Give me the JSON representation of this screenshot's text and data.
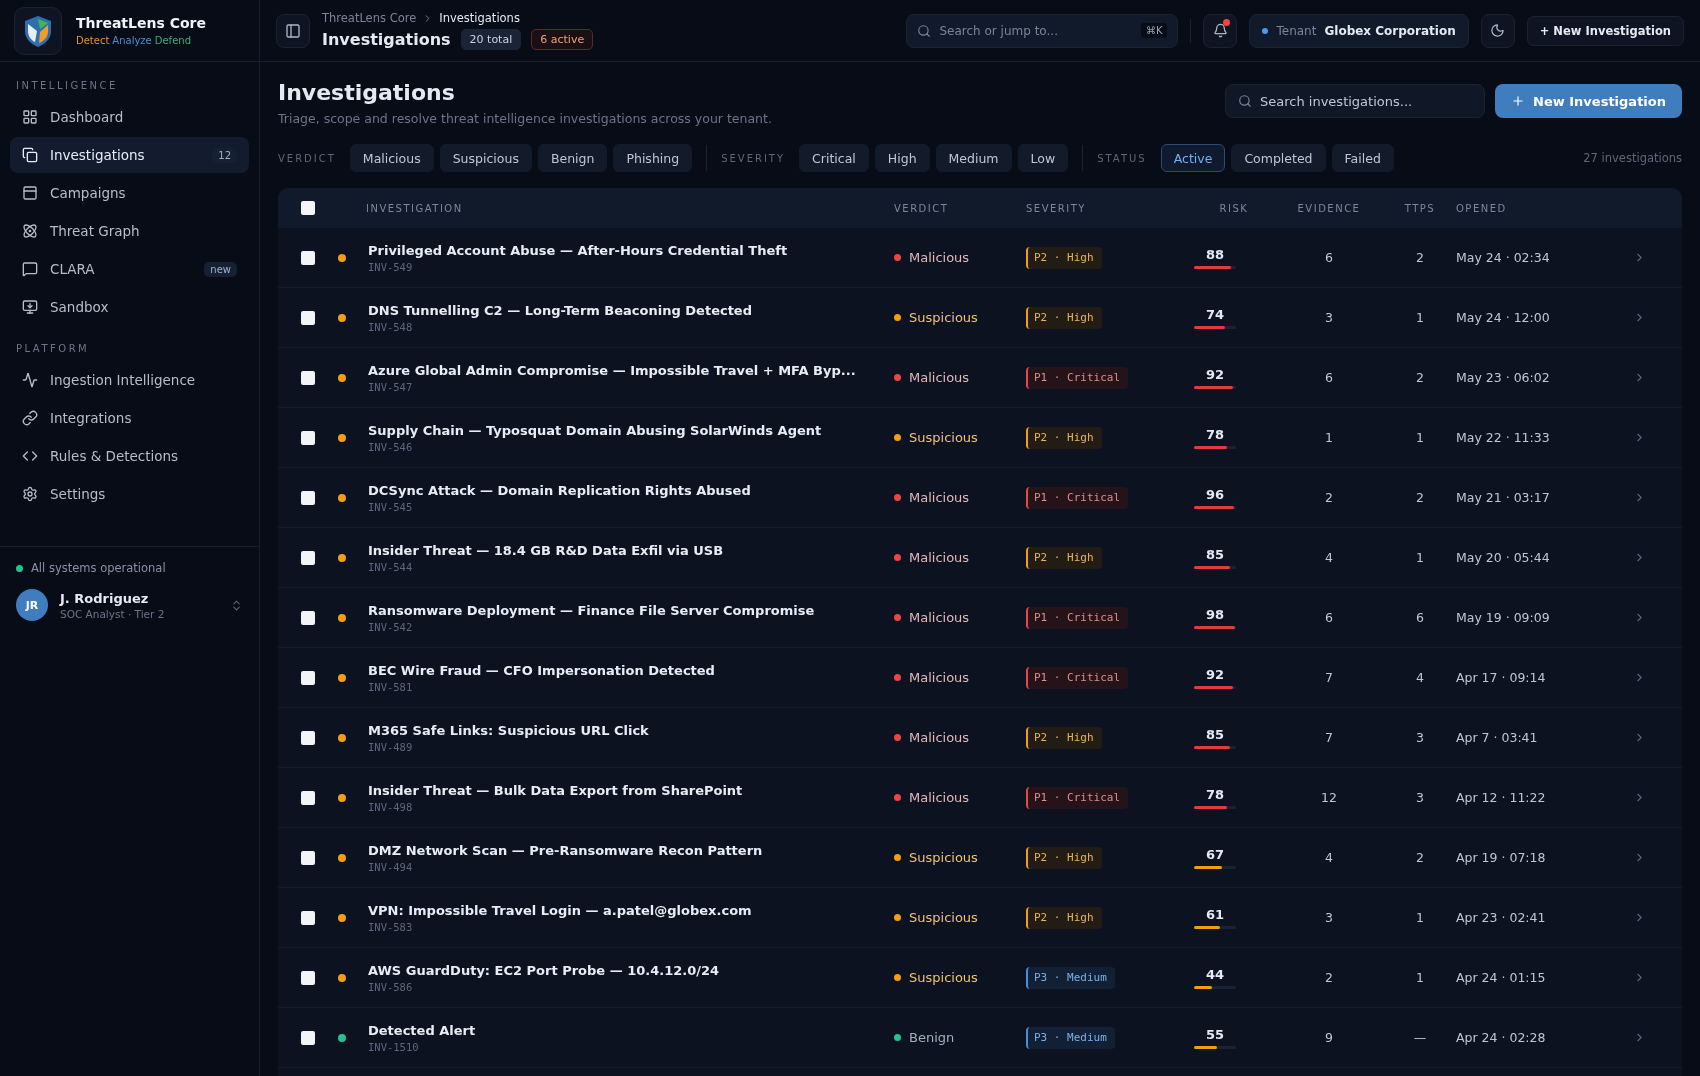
{
  "brand": {
    "name": "ThreatLens Core",
    "tagline": [
      {
        "text": "Detect",
        "color": "#e8922a"
      },
      {
        "text": "Analyze",
        "color": "#4a8fd6"
      },
      {
        "text": "Defend",
        "color": "#3fae7a"
      }
    ]
  },
  "sidebar": {
    "sections": [
      {
        "title": "INTELLIGENCE",
        "items": [
          {
            "label": "Dashboard",
            "selected": false
          },
          {
            "label": "Investigations",
            "selected": true,
            "badge": "12"
          },
          {
            "label": "Campaigns",
            "selected": false
          },
          {
            "label": "Threat Graph",
            "selected": false
          },
          {
            "label": "CLARA",
            "selected": false,
            "badge": "new"
          },
          {
            "label": "Sandbox",
            "selected": false
          }
        ]
      },
      {
        "title": "PLATFORM",
        "items": [
          {
            "label": "Ingestion Intelligence",
            "selected": false
          },
          {
            "label": "Integrations",
            "selected": false
          },
          {
            "label": "Rules & Detections",
            "selected": false
          },
          {
            "label": "Settings",
            "selected": false
          }
        ]
      }
    ],
    "status": "All systems operational",
    "user": {
      "initials": "JR",
      "name": "J. Rodriguez",
      "role": "SOC Analyst · Tier 2"
    }
  },
  "topbar": {
    "breadcrumb": [
      "ThreatLens Core",
      "Investigations"
    ],
    "title": "Investigations",
    "total": "20 total",
    "active": "6 active",
    "search_placeholder": "Search or jump to...",
    "shortcut": "⌘K",
    "tenant_label": "Tenant",
    "tenant": "Globex Corporation",
    "new_button": "+ New Investigation"
  },
  "page": {
    "title": "Investigations",
    "subtitle": "Triage, scope and resolve threat intelligence investigations across your tenant.",
    "search_placeholder": "Search investigations...",
    "new_button": "New Investigation",
    "count": "27 investigations"
  },
  "filters": [
    {
      "label": "VERDICT",
      "chips": [
        {
          "label": "Malicious",
          "selected": false
        },
        {
          "label": "Suspicious",
          "selected": false
        },
        {
          "label": "Benign",
          "selected": false
        },
        {
          "label": "Phishing",
          "selected": false
        }
      ]
    },
    {
      "label": "SEVERITY",
      "chips": [
        {
          "label": "Critical",
          "selected": false
        },
        {
          "label": "High",
          "selected": false
        },
        {
          "label": "Medium",
          "selected": false
        },
        {
          "label": "Low",
          "selected": false
        }
      ]
    },
    {
      "label": "STATUS",
      "chips": [
        {
          "label": "Active",
          "selected": true
        },
        {
          "label": "Completed",
          "selected": false
        },
        {
          "label": "Failed",
          "selected": false
        }
      ]
    }
  ],
  "table": {
    "select_all_checked": false,
    "columns": [
      "INVESTIGATION",
      "VERDICT",
      "SEVERITY",
      "RISK",
      "EVIDENCE",
      "TTPS",
      "OPENED"
    ],
    "rows": [
      {
        "checked": false,
        "color": "#f59e0b",
        "title": "Privileged Account Abuse — After-Hours Credential Theft",
        "id": "INV-549",
        "verdict": {
          "kind": "malicious",
          "label": "Malicious"
        },
        "severity": {
          "kind": "high",
          "label": "P2 · High"
        },
        "risk": "88",
        "level": 0.88,
        "evidence": "6",
        "ttps": "2",
        "opened": "May 24 · 02:34"
      },
      {
        "checked": false,
        "color": "#f59e0b",
        "title": "DNS Tunnelling C2 — Long-Term Beaconing Detected",
        "id": "INV-548",
        "verdict": {
          "kind": "suspicious",
          "label": "Suspicious"
        },
        "severity": {
          "kind": "high",
          "label": "P2 · High"
        },
        "risk": "74",
        "level": 0.74,
        "evidence": "3",
        "ttps": "1",
        "opened": "May 24 · 12:00"
      },
      {
        "checked": false,
        "color": "#f59e0b",
        "title": "Azure Global Admin Compromise — Impossible Travel + MFA Byp...",
        "id": "INV-547",
        "verdict": {
          "kind": "malicious",
          "label": "Malicious"
        },
        "severity": {
          "kind": "critical",
          "label": "P1 · Critical"
        },
        "risk": "92",
        "level": 0.92,
        "evidence": "6",
        "ttps": "2",
        "opened": "May 23 · 06:02"
      },
      {
        "checked": false,
        "color": "#f59e0b",
        "title": "Supply Chain — Typosquat Domain Abusing SolarWinds Agent",
        "id": "INV-546",
        "verdict": {
          "kind": "suspicious",
          "label": "Suspicious"
        },
        "severity": {
          "kind": "high",
          "label": "P2 · High"
        },
        "risk": "78",
        "level": 0.78,
        "evidence": "1",
        "ttps": "1",
        "opened": "May 22 · 11:33"
      },
      {
        "checked": false,
        "color": "#f59e0b",
        "title": "DCSync Attack — Domain Replication Rights Abused",
        "id": "INV-545",
        "verdict": {
          "kind": "malicious",
          "label": "Malicious"
        },
        "severity": {
          "kind": "critical",
          "label": "P1 · Critical"
        },
        "risk": "96",
        "level": 0.96,
        "evidence": "2",
        "ttps": "2",
        "opened": "May 21 · 03:17"
      },
      {
        "checked": false,
        "color": "#f59e0b",
        "title": "Insider Threat — 18.4 GB R&D Data Exfil via USB",
        "id": "INV-544",
        "verdict": {
          "kind": "malicious",
          "label": "Malicious"
        },
        "severity": {
          "kind": "high",
          "label": "P2 · High"
        },
        "risk": "85",
        "level": 0.85,
        "evidence": "4",
        "ttps": "1",
        "opened": "May 20 · 05:44"
      },
      {
        "checked": false,
        "color": "#f59e0b",
        "title": "Ransomware Deployment — Finance File Server Compromise",
        "id": "INV-542",
        "verdict": {
          "kind": "malicious",
          "label": "Malicious"
        },
        "severity": {
          "kind": "critical",
          "label": "P1 · Critical"
        },
        "risk": "98",
        "level": 0.98,
        "evidence": "6",
        "ttps": "6",
        "opened": "May 19 · 09:09"
      },
      {
        "checked": false,
        "color": "#f59e0b",
        "title": "BEC Wire Fraud — CFO Impersonation Detected",
        "id": "INV-581",
        "verdict": {
          "kind": "malicious",
          "label": "Malicious"
        },
        "severity": {
          "kind": "critical",
          "label": "P1 · Critical"
        },
        "risk": "92",
        "level": 0.92,
        "evidence": "7",
        "ttps": "4",
        "opened": "Apr 17 · 09:14"
      },
      {
        "checked": false,
        "color": "#f59e0b",
        "title": "M365 Safe Links: Suspicious URL Click",
        "id": "INV-489",
        "verdict": {
          "kind": "malicious",
          "label": "Malicious"
        },
        "severity": {
          "kind": "high",
          "label": "P2 · High"
        },
        "risk": "85",
        "level": 0.85,
        "evidence": "7",
        "ttps": "3",
        "opened": "Apr 7 · 03:41"
      },
      {
        "checked": false,
        "color": "#f59e0b",
        "title": "Insider Threat — Bulk Data Export from SharePoint",
        "id": "INV-498",
        "verdict": {
          "kind": "malicious",
          "label": "Malicious"
        },
        "severity": {
          "kind": "critical",
          "label": "P1 · Critical"
        },
        "risk": "78",
        "level": 0.78,
        "evidence": "12",
        "ttps": "3",
        "opened": "Apr 12 · 11:22"
      },
      {
        "checked": false,
        "color": "#f59e0b",
        "title": "DMZ Network Scan — Pre-Ransomware Recon Pattern",
        "id": "INV-494",
        "verdict": {
          "kind": "suspicious",
          "label": "Suspicious"
        },
        "severity": {
          "kind": "high",
          "label": "P2 · High"
        },
        "risk": "67",
        "level": 0.67,
        "evidence": "4",
        "ttps": "2",
        "opened": "Apr 19 · 07:18"
      },
      {
        "checked": false,
        "color": "#f59e0b",
        "title": "VPN: Impossible Travel Login — a.patel@globex.com",
        "id": "INV-583",
        "verdict": {
          "kind": "suspicious",
          "label": "Suspicious"
        },
        "severity": {
          "kind": "high",
          "label": "P2 · High"
        },
        "risk": "61",
        "level": 0.61,
        "evidence": "3",
        "ttps": "1",
        "opened": "Apr 23 · 02:41"
      },
      {
        "checked": false,
        "color": "#f59e0b",
        "title": "AWS GuardDuty: EC2 Port Probe — 10.4.12.0/24",
        "id": "INV-586",
        "verdict": {
          "kind": "suspicious",
          "label": "Suspicious"
        },
        "severity": {
          "kind": "medium",
          "label": "P3 · Medium"
        },
        "risk": "44",
        "level": 0.44,
        "evidence": "2",
        "ttps": "1",
        "opened": "Apr 24 · 01:15"
      },
      {
        "checked": false,
        "color": "#22c38e",
        "title": "Detected Alert",
        "id": "INV-1510",
        "verdict": {
          "kind": "benign",
          "label": "Benign"
        },
        "severity": {
          "kind": "medium",
          "label": "P3 · Medium"
        },
        "risk": "55",
        "level": 0.55,
        "evidence": "9",
        "ttps": "—",
        "opened": "Apr 24 · 02:28"
      }
    ]
  }
}
